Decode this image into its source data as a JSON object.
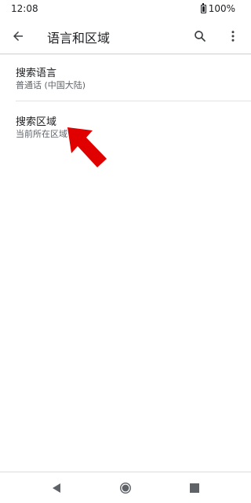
{
  "status_bar": {
    "time": "12:08",
    "battery": "100%"
  },
  "app_bar": {
    "title": "语言和区域"
  },
  "settings": [
    {
      "title": "搜索语言",
      "subtitle": "普通话 (中国大陆)"
    },
    {
      "title": "搜索区域",
      "subtitle": "当前所在区域"
    }
  ],
  "icons": {
    "back": "arrow-back-icon",
    "search": "search-icon",
    "more": "more-vert-icon",
    "battery": "battery-icon",
    "pointer": "red-arrow-pointer",
    "nav_back": "triangle-back-icon",
    "nav_home": "circle-home-icon",
    "nav_recents": "square-recents-icon"
  },
  "colors": {
    "pointer": "#e00000",
    "text_primary": "#202124",
    "text_secondary": "#5f6368"
  }
}
